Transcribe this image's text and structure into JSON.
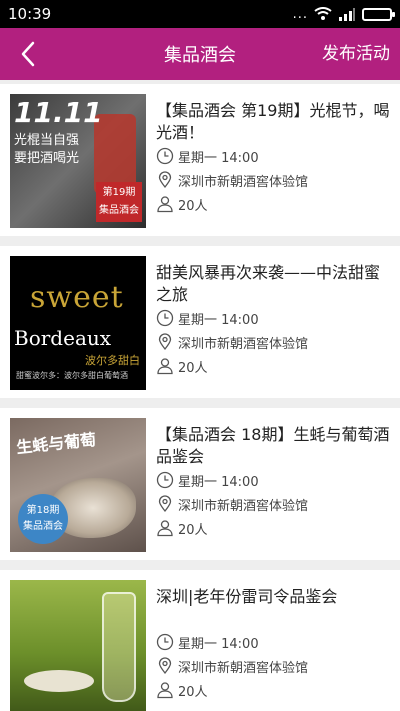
{
  "status_bar": {
    "time": "10:39",
    "dots": "..."
  },
  "header": {
    "title": "集品酒会",
    "action_label": "发布活动",
    "bg_color": "#b2207f"
  },
  "events": [
    {
      "title": "【集品酒会 第19期】光棍节，喝光酒！",
      "time": "星期一 14:00",
      "location": "深圳市新朝酒窖体验馆",
      "attendees": "20人",
      "thumb": {
        "headline": "11.11",
        "hand_line1": "光棍当自强",
        "hand_line2": "要把酒喝光",
        "tag_line1": "第19期",
        "tag_line2": "集品酒会"
      }
    },
    {
      "title": "甜美风暴再次来袭——中法甜蜜之旅",
      "time": "星期一 14:00",
      "location": "深圳市新朝酒窖体验馆",
      "attendees": "20人",
      "thumb": {
        "line1": "sweet",
        "line2": "Bordeaux",
        "line3": "波尔多甜白",
        "line4": "甜蜜波尔多：波尔多甜白葡萄酒"
      }
    },
    {
      "title": "【集品酒会 18期】生蚝与葡萄酒品鉴会",
      "time": "星期一 14:00",
      "location": "深圳市新朝酒窖体验馆",
      "attendees": "20人",
      "thumb": {
        "headline": "生蚝与葡萄",
        "badge_line1": "第18期",
        "badge_line2": "集品酒会"
      }
    },
    {
      "title": "深圳|老年份雷司令品鉴会",
      "time": "星期一 14:00",
      "location": "深圳市新朝酒窖体验馆",
      "attendees": "20人"
    }
  ]
}
